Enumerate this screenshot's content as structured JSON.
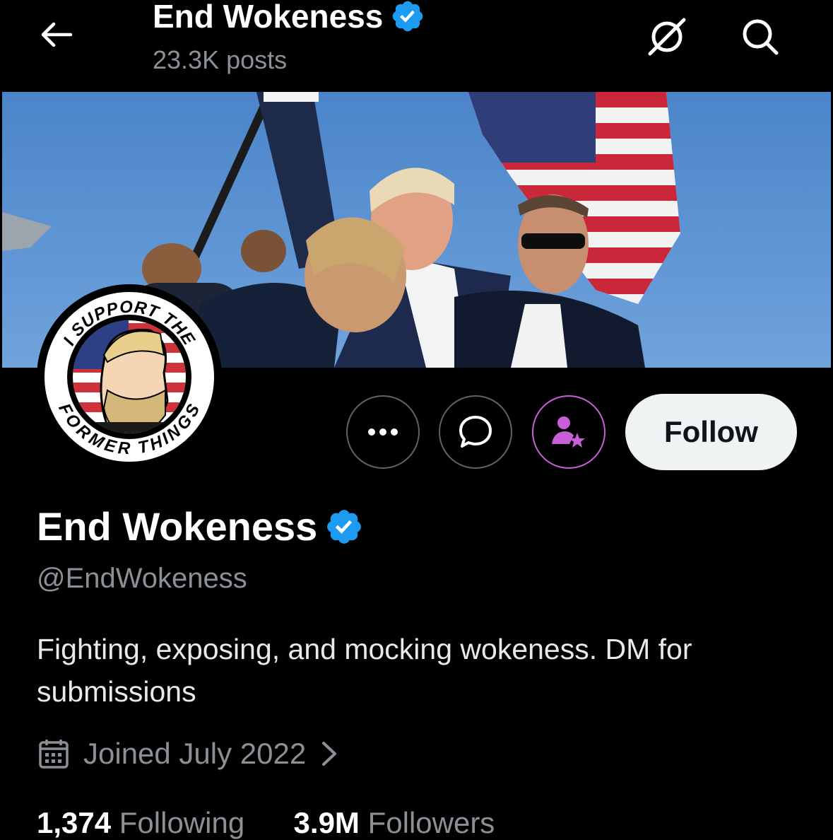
{
  "header": {
    "title": "End Wokeness",
    "posts_count": "23.3K posts"
  },
  "banner": {
    "description": "Photo of a man raising his fist with secret service agents and an American flag"
  },
  "avatar": {
    "top_text": "I SUPPORT THE",
    "bottom_text": "FORMER THINGS"
  },
  "actions": {
    "follow_label": "Follow"
  },
  "profile": {
    "name": "End Wokeness",
    "handle": "@EndWokeness",
    "bio": "Fighting, exposing, and mocking wokeness. DM for submissions",
    "joined": "Joined July 2022"
  },
  "stats": {
    "following_count": "1,374",
    "following_label": "Following",
    "followers_count": "3.9M",
    "followers_label": "Followers"
  },
  "colors": {
    "verified": "#1d9bf0",
    "subscribe_accent": "#c85ed8",
    "background": "#000000"
  }
}
